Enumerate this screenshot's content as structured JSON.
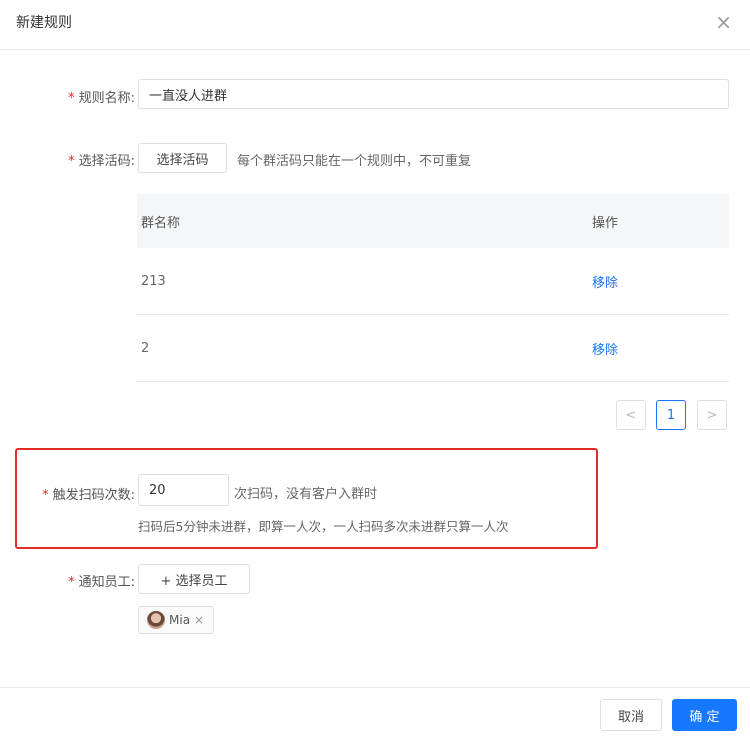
{
  "dialog": {
    "title": "新建规则",
    "close_glyph": "×"
  },
  "rule_name": {
    "label": "规则名称:",
    "value": "一直没人进群"
  },
  "select_code": {
    "label": "选择活码:",
    "button": "选择活码",
    "hint": "每个群活码只能在一个规则中，不可重复"
  },
  "table": {
    "headers": [
      "群名称",
      "操作"
    ],
    "rows": [
      {
        "name": "213",
        "action": "移除"
      },
      {
        "name": "2",
        "action": "移除"
      }
    ]
  },
  "pagination": {
    "prev": "<",
    "current": "1",
    "next": ">"
  },
  "trigger": {
    "label": "触发扫码次数:",
    "value": "20",
    "suffix": "次扫码，没有客户入群时",
    "hint": "扫码后5分钟未进群，即算一人次，一人扫码多次未进群只算一人次"
  },
  "notify": {
    "label": "通知员工:",
    "button": "+ 选择员工",
    "staff_tag": "Mia",
    "tag_close": "×"
  },
  "footer": {
    "cancel": "取消",
    "confirm": "确 定"
  },
  "required_mark": "*",
  "colors": {
    "primary": "#1677ff",
    "required": "#f5222d",
    "highlight_box": "#e32b2b"
  }
}
